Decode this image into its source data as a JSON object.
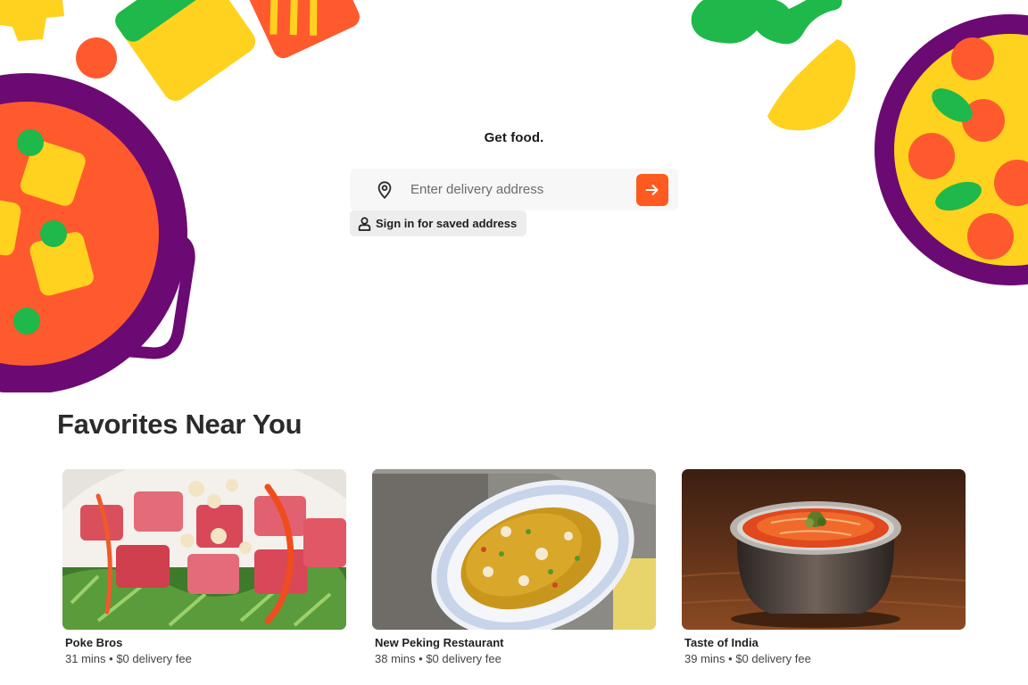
{
  "hero": {
    "title": "Get food.",
    "address_placeholder": "Enter delivery address",
    "signin_label": "Sign in for saved address"
  },
  "favorites": {
    "title": "Favorites Near You",
    "items": [
      {
        "name": "Poke Bros",
        "time": "31 mins",
        "fee": "$0 delivery fee",
        "image": "poke-bowl-photo"
      },
      {
        "name": "New Peking Restaurant",
        "time": "38 mins",
        "fee": "$0 delivery fee",
        "image": "fried-rice-photo"
      },
      {
        "name": "Taste of India",
        "time": "39 mins",
        "fee": "$0 delivery fee",
        "image": "curry-bowl-photo"
      }
    ]
  },
  "meta_separator": " • ",
  "icons": {
    "location": "map-pin-icon",
    "submit": "arrow-right-icon",
    "signin": "person-icon"
  },
  "colors": {
    "accent": "#ff5a1f",
    "purple": "#6b0a72",
    "yellow": "#ffd21f",
    "green": "#1fb84a",
    "red": "#ff5a2e"
  }
}
